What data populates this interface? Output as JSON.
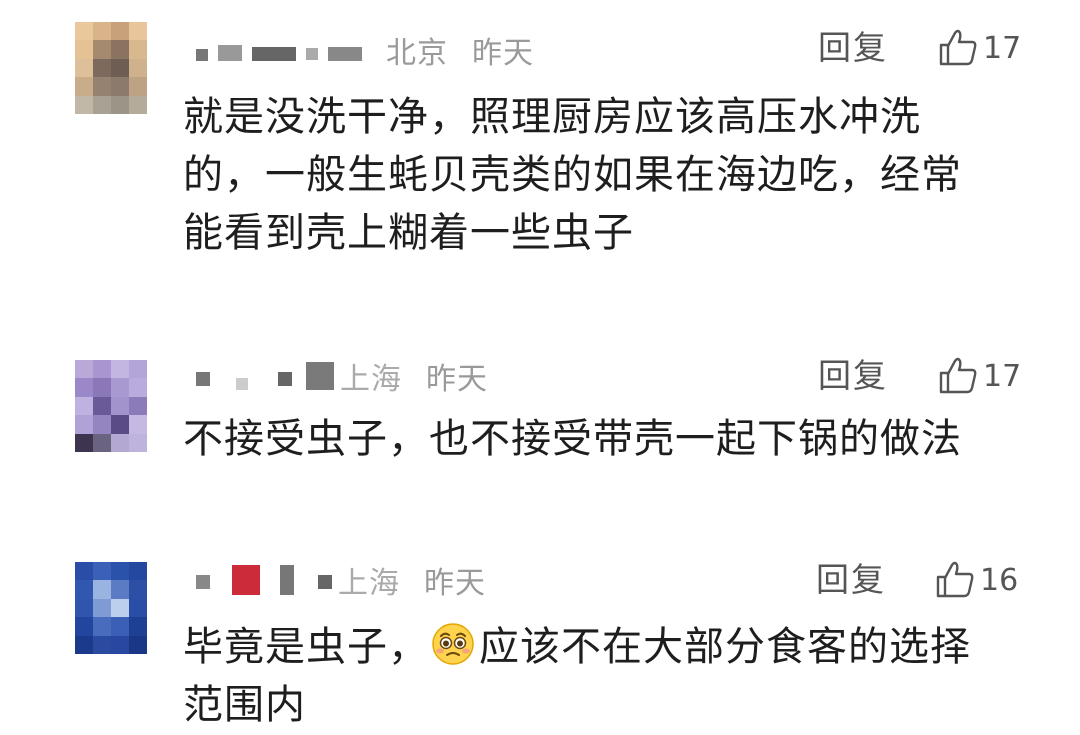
{
  "comments": [
    {
      "location": "北京",
      "time": "昨天",
      "reply_label": "回复",
      "likes": "17",
      "text_lines": [
        "就是没洗干净，照理厨房应该高压水冲洗",
        "的，一般生蚝贝壳类的如果在海边吃，经常",
        "能看到壳上糊着一些虫子"
      ]
    },
    {
      "location": "上海",
      "time": "昨天",
      "reply_label": "回复",
      "likes": "17",
      "text_lines": [
        "不接受虫子，也不接受带壳一起下锅的做法"
      ]
    },
    {
      "location": "上海",
      "time": "昨天",
      "reply_label": "回复",
      "likes": "16",
      "text_before_emoji": "毕竟是虫子，",
      "emoji": "pleading-face-icon",
      "text_after_emoji": "应该不在大部分食客的选择",
      "text_line_2": "范围内"
    }
  ],
  "colors": {
    "meta_gray": "#9a9a9a",
    "action_gray": "#555555",
    "text": "#1e1e1e"
  }
}
